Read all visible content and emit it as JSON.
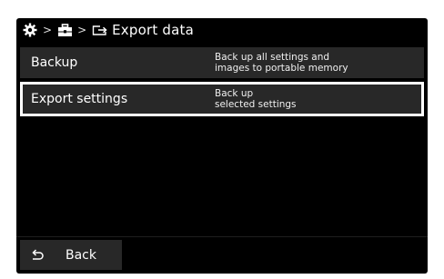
{
  "header": {
    "breadcrumb_icons": [
      "gear-icon",
      "toolbox-icon",
      "export-icon"
    ],
    "separator": ">",
    "title": "Export data"
  },
  "list": {
    "items": [
      {
        "label": "Backup",
        "description_lines": [
          "Back up all settings and",
          "images to portable memory"
        ],
        "selected": false
      },
      {
        "label": "Export settings",
        "description_lines": [
          "Back up",
          "selected settings"
        ],
        "selected": true
      }
    ]
  },
  "footer": {
    "back_label": "Back",
    "back_icon": "return-arrow-icon"
  },
  "colors": {
    "screen_background": "#000000",
    "item_background": "#282828",
    "text": "#ffffff",
    "selection_border": "#ffffff"
  }
}
